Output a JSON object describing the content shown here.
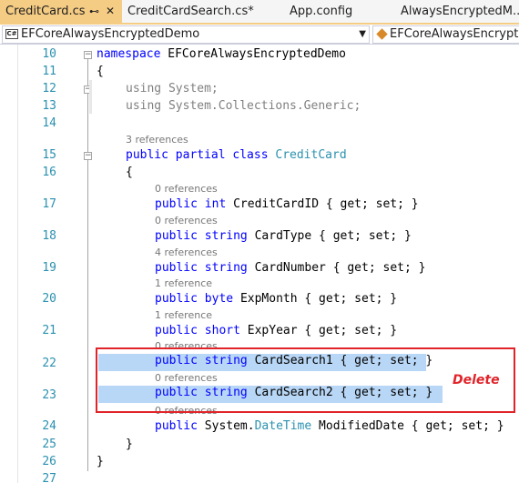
{
  "tabs": [
    {
      "label": "CreditCard.cs",
      "pin": "⊷",
      "close": "✕",
      "active": true
    },
    {
      "label": "CreditCardSearch.cs*",
      "active": false
    },
    {
      "label": "App.config",
      "active": false
    },
    {
      "label": "AlwaysEncryptedM...l...",
      "active": false
    }
  ],
  "navbar": {
    "project_badge": "C#",
    "project": "EFCoreAlwaysEncryptedDemo",
    "namespace": "EFCoreAlwaysEncrypted",
    "dropdown_glyph": "▼"
  },
  "line_numbers": [
    "10",
    "11",
    "12",
    "13",
    "14",
    "15",
    "16",
    "17",
    "18",
    "19",
    "20",
    "21",
    "22",
    "23",
    "24",
    "25",
    "26",
    "27"
  ],
  "code": {
    "namespace_kw": "namespace",
    "namespace_name": " EFCoreAlwaysEncryptedDemo",
    "open_ns": "{",
    "using1_kw": "using",
    "using1_rest": " System;",
    "using2_kw": "using",
    "using2_rest": " System.Collections.Generic;",
    "class_refs": "3 references",
    "class_kw": "public partial class",
    "class_name": "CreditCard",
    "open_class": "{",
    "props": [
      {
        "refs": "0 references",
        "kw1": "public",
        "type": "int",
        "name": "CreditCardID",
        "rest": "{ get; set; }"
      },
      {
        "refs": "0 references",
        "kw1": "public",
        "type": "string",
        "name": "CardType",
        "rest": "{ get; set; }"
      },
      {
        "refs": "4 references",
        "kw1": "public",
        "type": "string",
        "name": "CardNumber",
        "rest": "{ get; set; }"
      },
      {
        "refs": "1 reference",
        "kw1": "public",
        "type": "byte",
        "name": "ExpMonth",
        "rest": "{ get; set; }"
      },
      {
        "refs": "1 reference",
        "kw1": "public",
        "type": "short",
        "name": "ExpYear",
        "rest": "{ get; set; }"
      },
      {
        "refs": "0 references",
        "kw1": "public",
        "type": "string",
        "name": "CardSearch1",
        "rest": "{ get; set; }"
      },
      {
        "refs": "0 references",
        "kw1": "public",
        "type": "string",
        "name": "CardSearch2",
        "rest": "{ get; set; }"
      },
      {
        "refs": "0 references",
        "kw1": "public",
        "type_ns": "System.",
        "type": "DateTime",
        "name": "ModifiedDate",
        "rest": "{ get; set; }"
      }
    ],
    "close_class": "}",
    "close_ns": "}"
  },
  "annotation": {
    "label": "Delete",
    "color": "#e0242a"
  },
  "colors": {
    "keyword": "#0000ff",
    "type": "#2b91af",
    "line_number": "#2b91af",
    "active_tab": "#f5cc84",
    "selection": "#b8d6f5"
  }
}
